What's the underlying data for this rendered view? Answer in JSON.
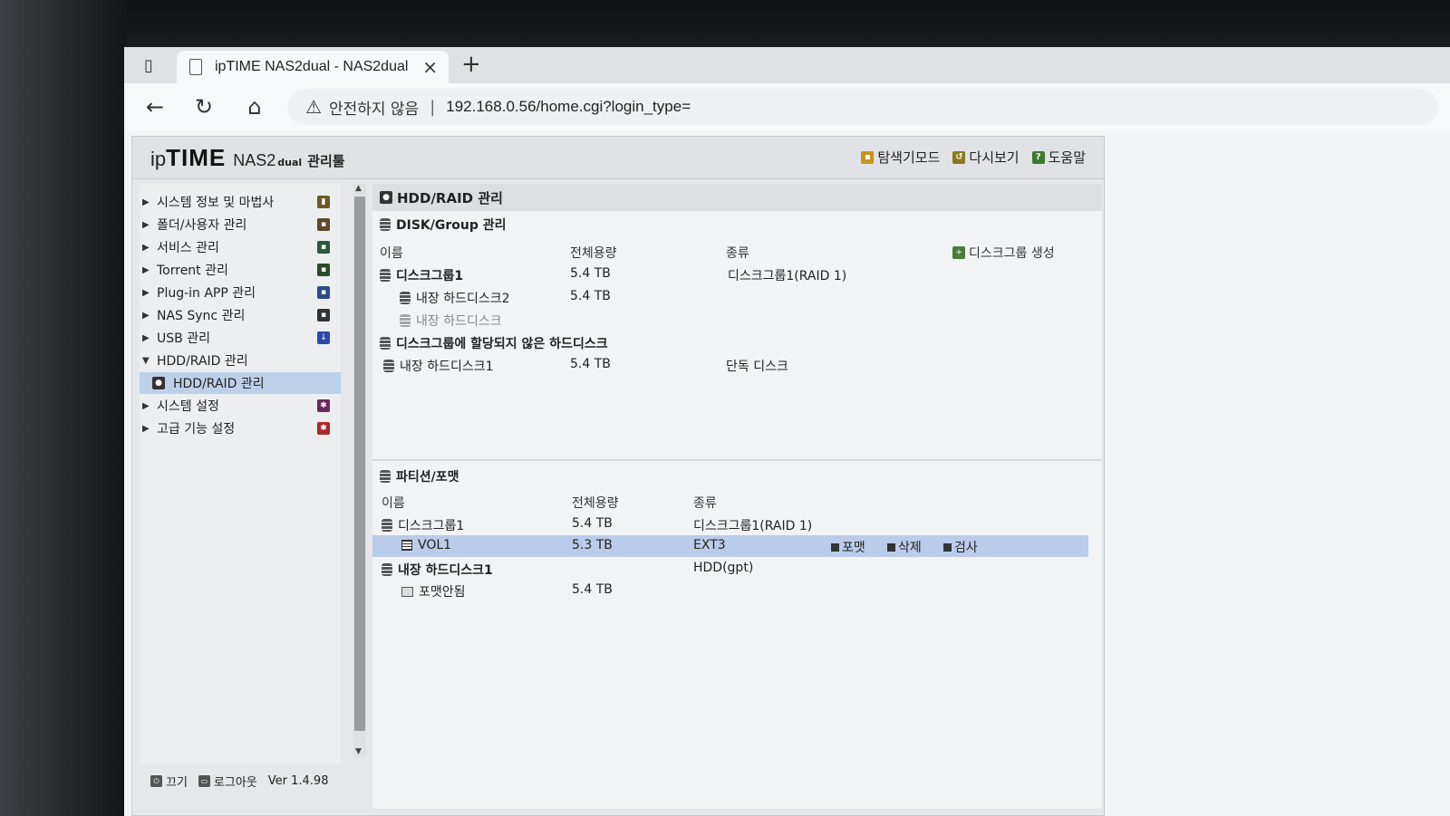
{
  "browser": {
    "tab_title": "ipTIME NAS2dual - NAS2dual",
    "security_label": "안전하지 않음",
    "url": "192.168.0.56/home.cgi?login_type="
  },
  "header": {
    "logo_ip": "ip",
    "logo_time": "TIME",
    "logo_model": "NAS2",
    "logo_dual": "dual",
    "logo_suffix": "관리툴",
    "actions": [
      {
        "label": "탐색기모드",
        "color": "#c8941e"
      },
      {
        "label": "다시보기",
        "color": "#8a7a1e"
      },
      {
        "label": "도움말",
        "color": "#3d7a2e"
      }
    ]
  },
  "sidebar": {
    "items": [
      {
        "label": "시스템 정보 및 마법사",
        "icon": "chart-icon",
        "color": "#6a5a2a"
      },
      {
        "label": "폴더/사용자 관리",
        "icon": "folder-user-icon",
        "color": "#5a4a2a"
      },
      {
        "label": "서비스 관리",
        "icon": "service-icon",
        "color": "#2a5a3a"
      },
      {
        "label": "Torrent 관리",
        "icon": "torrent-icon",
        "color": "#2a4a2a"
      },
      {
        "label": "Plug-in APP 관리",
        "icon": "plugin-icon",
        "color": "#2a4a8a"
      },
      {
        "label": "NAS Sync 관리",
        "icon": "sync-icon",
        "color": "#333333"
      },
      {
        "label": "USB 관리",
        "icon": "usb-icon",
        "color": "#2a4aaa"
      },
      {
        "label": "HDD/RAID 관리",
        "icon": "",
        "color": ""
      },
      {
        "label": "HDD/RAID 관리",
        "icon": "hdd-icon",
        "color": "#333333"
      },
      {
        "label": "시스템 설정",
        "icon": "system-settings-icon",
        "color": "#6a2a5a"
      },
      {
        "label": "고급 기능 설정",
        "icon": "advanced-settings-icon",
        "color": "#aa2a2a"
      }
    ]
  },
  "footer": {
    "power_label": "끄기",
    "logout_label": "로그아웃",
    "version": "Ver 1.4.98"
  },
  "main": {
    "panel_title": "HDD/RAID 관리",
    "disk_group": {
      "title": "DISK/Group 관리",
      "columns": [
        "이름",
        "전체용량",
        "종류"
      ],
      "create_label": "디스크그룹 생성",
      "rows": [
        {
          "name": "디스크그룹1",
          "size": "5.4 TB",
          "type": "디스크그룹1(RAID 1)"
        },
        {
          "name": "내장 하드디스크2",
          "size": "5.4 TB",
          "type": ""
        },
        {
          "name": "내장 하드디스크",
          "size": "",
          "type": ""
        },
        {
          "name": "디스크그룹에 할당되지 않은 하드디스크",
          "size": "",
          "type": ""
        },
        {
          "name": "내장 하드디스크1",
          "size": "5.4 TB",
          "type": "단독 디스크"
        }
      ]
    },
    "partition": {
      "title": "파티션/포맷",
      "columns": [
        "이름",
        "전체용량",
        "종류"
      ],
      "rows": [
        {
          "name": "디스크그룹1",
          "size": "5.4 TB",
          "type": "디스크그룹1(RAID 1)"
        },
        {
          "name": "VOL1",
          "size": "5.3 TB",
          "type": "EXT3"
        },
        {
          "name": "내장 하드디스크1",
          "size": "",
          "type": "HDD(gpt)"
        },
        {
          "name": "포맷안됨",
          "size": "5.4 TB",
          "type": ""
        }
      ],
      "actions": [
        "포맷",
        "삭제",
        "검사"
      ]
    }
  }
}
